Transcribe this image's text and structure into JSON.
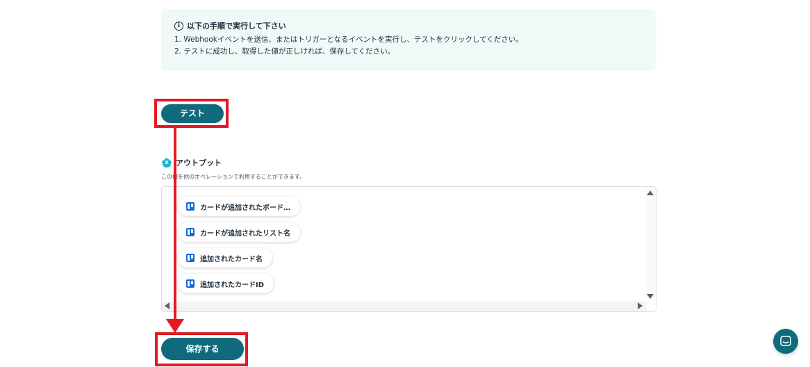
{
  "notice": {
    "title": "以下の手順で実行して下さい",
    "step1": "1. Webhookイベントを送信、またはトリガーとなるイベントを実行し、テストをクリックしてください。",
    "step2": "2. テストに成功し、取得した値が正しければ、保存してください。"
  },
  "test_button": "テスト",
  "output": {
    "title": "アウトプット",
    "description": "この値を他のオペレーションで利用することができます。",
    "items": [
      "カードが追加されたボード…",
      "カードが追加されたリスト名",
      "追加されたカード名",
      "追加されたカードID"
    ]
  },
  "save_button": "保存する",
  "icons": {
    "info": "info-icon",
    "output": "output-icon",
    "item": "trello-icon",
    "chat": "chat-icon"
  },
  "colors": {
    "primary": "#0f6b7c",
    "highlight": "#e21a23",
    "notice_bg": "#f1f9f8",
    "trello": "#1868db"
  }
}
